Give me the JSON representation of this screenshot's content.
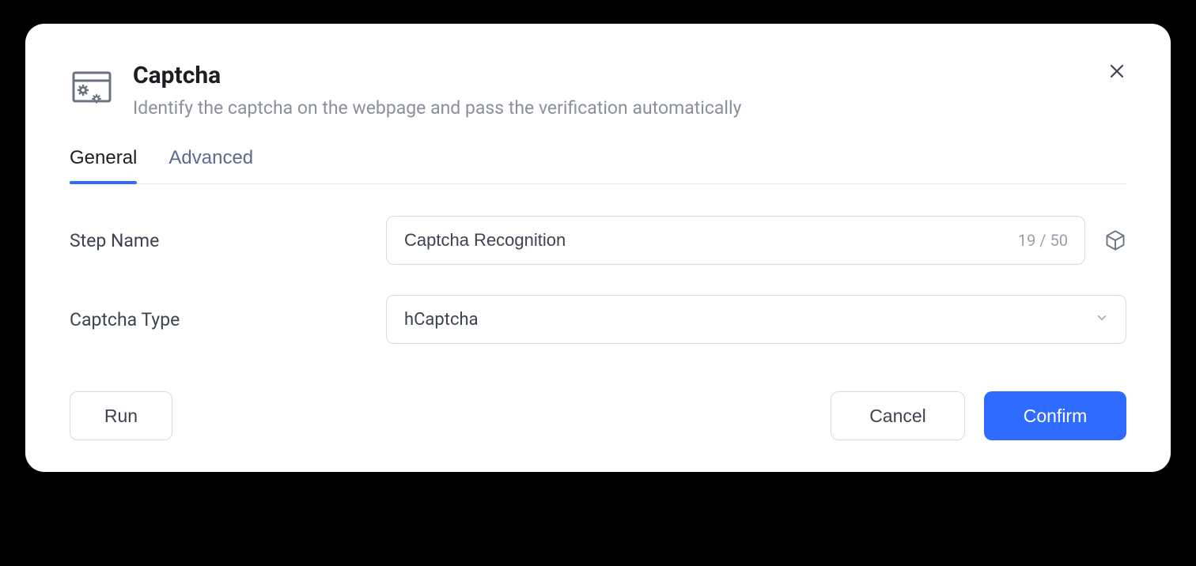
{
  "header": {
    "title": "Captcha",
    "subtitle": "Identify the captcha on the webpage and pass the verification automatically"
  },
  "tabs": {
    "general": "General",
    "advanced": "Advanced",
    "active": "general"
  },
  "form": {
    "step_name": {
      "label": "Step Name",
      "value": "Captcha Recognition",
      "char_count": "19 / 50"
    },
    "captcha_type": {
      "label": "Captcha Type",
      "value": "hCaptcha"
    }
  },
  "footer": {
    "run": "Run",
    "cancel": "Cancel",
    "confirm": "Confirm"
  }
}
